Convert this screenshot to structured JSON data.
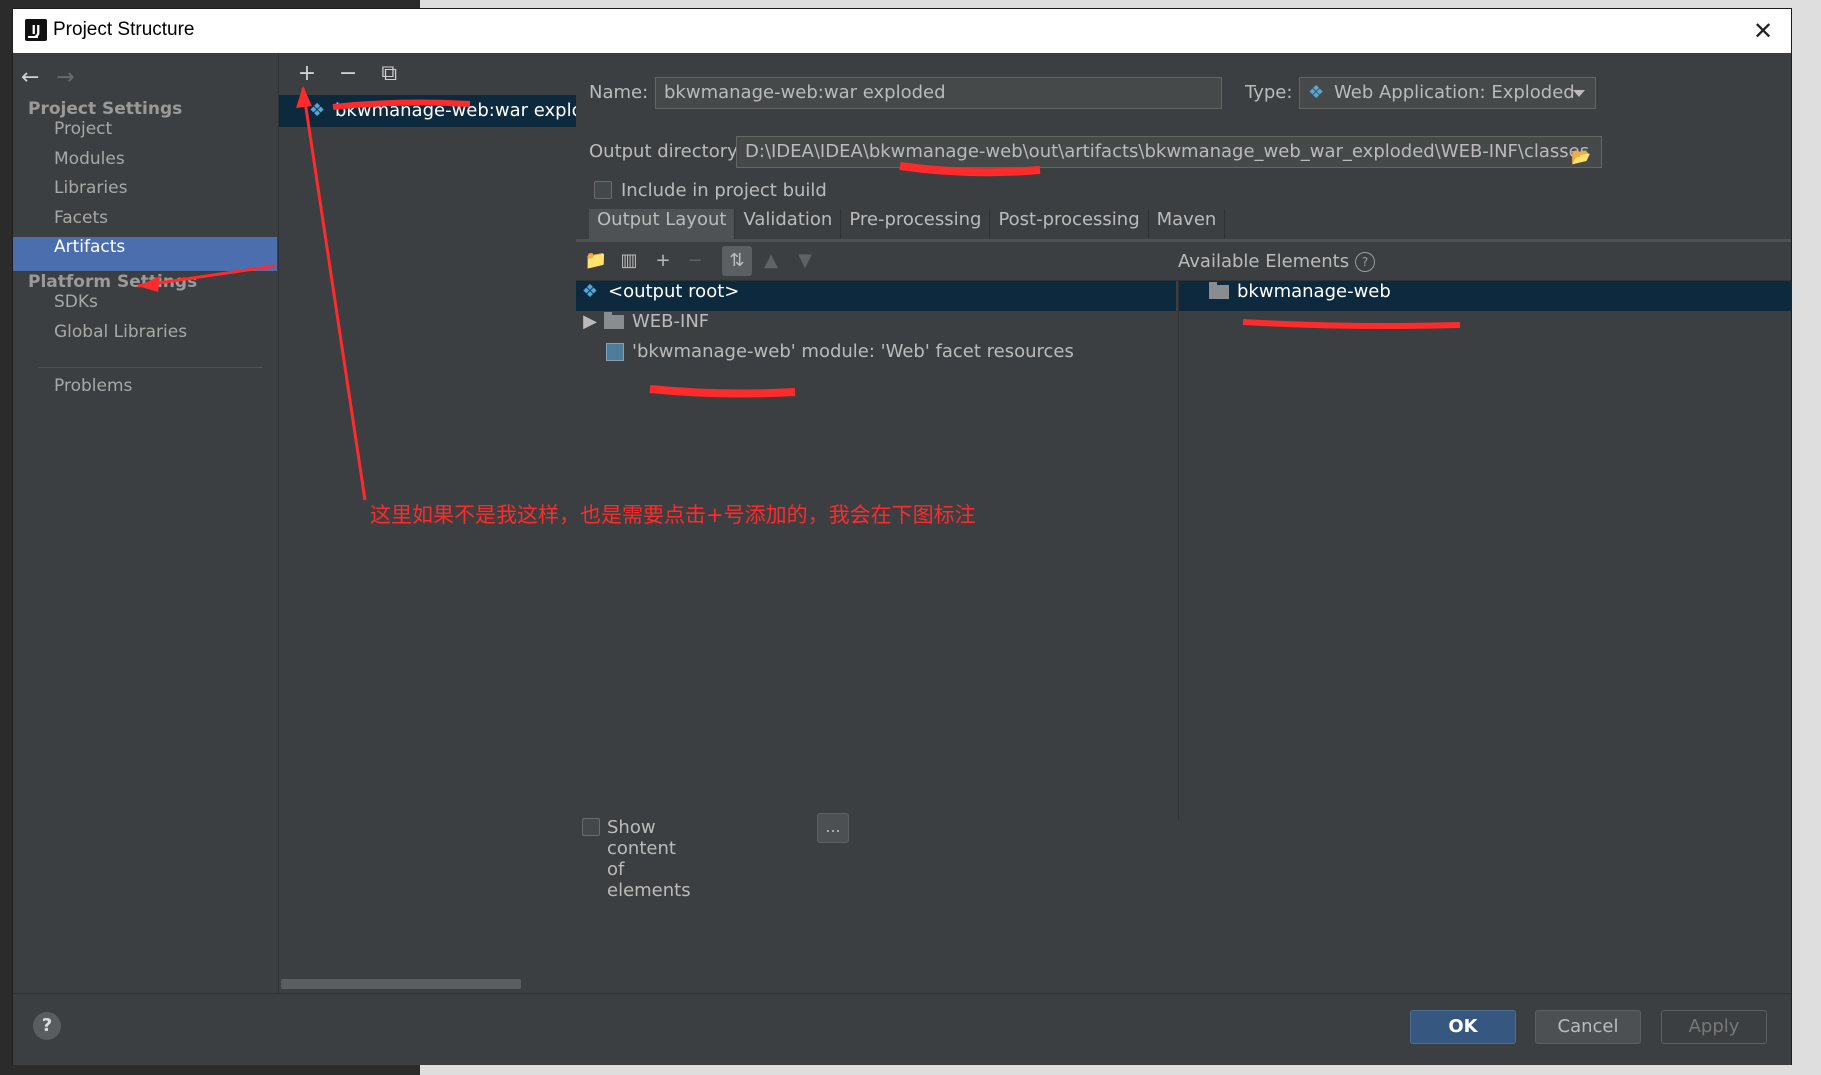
{
  "window": {
    "title": "Project Structure",
    "close_icon": "✕"
  },
  "nav": {
    "back_icon": "←",
    "forward_icon": "→",
    "project_settings_label": "Project Settings",
    "project_items": [
      "Project",
      "Modules",
      "Libraries",
      "Facets",
      "Artifacts"
    ],
    "selected_item": "Artifacts",
    "platform_settings_label": "Platform Settings",
    "platform_items": [
      "SDKs",
      "Global Libraries"
    ],
    "problems_label": "Problems"
  },
  "artifact_list": {
    "add_icon": "+",
    "remove_icon": "−",
    "copy_icon": "⧉",
    "items": [
      "bkwmanage-web:war exploded"
    ]
  },
  "details": {
    "name_label": "Name:",
    "name_value": "bkwmanage-web:war exploded",
    "type_label": "Type:",
    "type_value": "Web Application: Exploded",
    "output_dir_label": "Output directory:",
    "output_dir_value": "D:\\IDEA\\IDEA\\bkwmanage-web\\out\\artifacts\\bkwmanage_web_war_exploded\\WEB-INF\\classes",
    "include_build_label": "Include in project build",
    "include_build_checked": false
  },
  "tabs": [
    "Output Layout",
    "Validation",
    "Pre-processing",
    "Post-processing",
    "Maven"
  ],
  "active_tab": "Output Layout",
  "layout": {
    "available_elements_label": "Available Elements",
    "tree": [
      {
        "label": "<output root>",
        "selected": true
      },
      {
        "label": "WEB-INF",
        "expandable": true
      },
      {
        "label": "'bkwmanage-web' module: 'Web' facet resources"
      }
    ],
    "available": [
      {
        "label": "bkwmanage-web"
      }
    ],
    "show_content_label": "Show content of elements",
    "dots_label": "..."
  },
  "footer": {
    "help_label": "?",
    "ok_label": "OK",
    "cancel_label": "Cancel",
    "apply_label": "Apply"
  },
  "annotation": {
    "text": "这里如果不是我这样，也是需要点击+号添加的，我会在下图标注",
    "color": "#ff2a2a"
  },
  "colors": {
    "dialog_bg": "#3c3f41",
    "selection": "#4b6eaf",
    "tree_selection": "#0d293e",
    "primary_button": "#365880"
  }
}
